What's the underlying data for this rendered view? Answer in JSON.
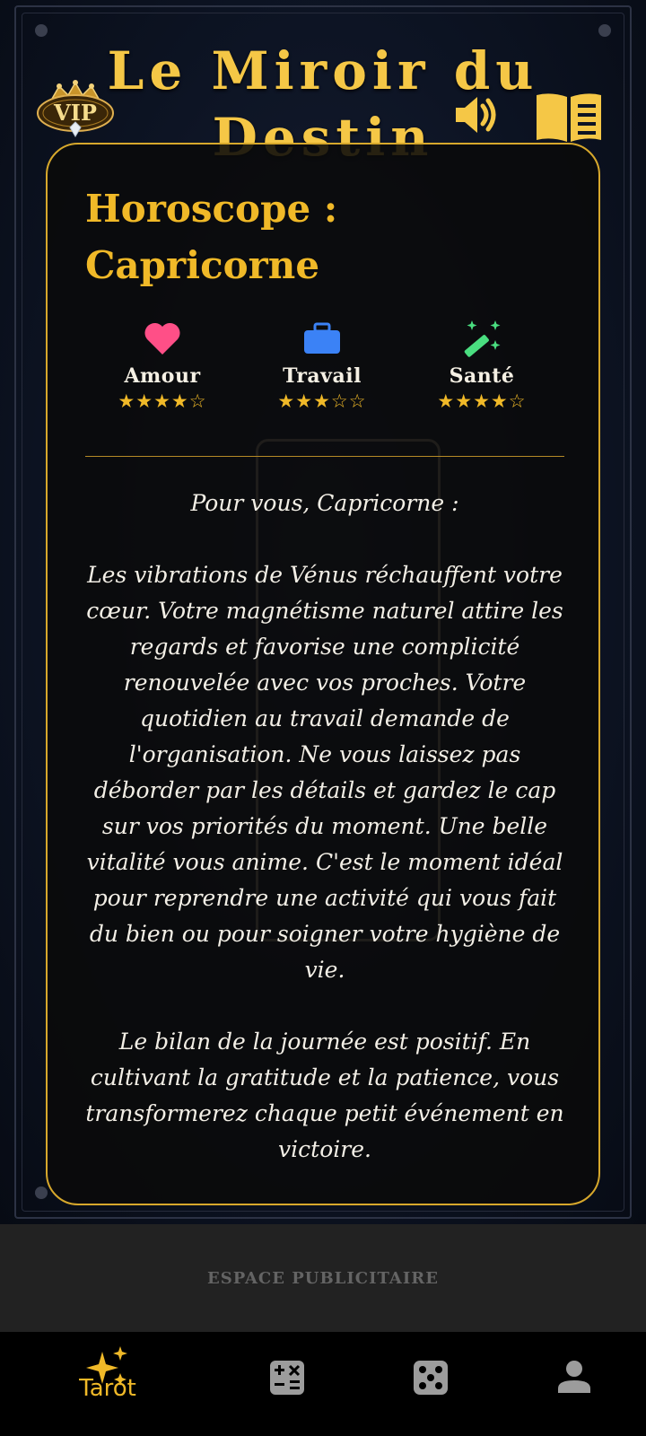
{
  "header": {
    "title": "Le Miroir du Destin",
    "vip_badge": "VIP"
  },
  "horoscope": {
    "title_line1": "Horoscope :",
    "title_line2": "Capricorne",
    "metrics": [
      {
        "label": "Amour",
        "rating": 4,
        "max": 5,
        "stars": "★★★★☆",
        "icon": "heart-icon",
        "color": "#ff4f87"
      },
      {
        "label": "Travail",
        "rating": 3,
        "max": 5,
        "stars": "★★★☆☆",
        "icon": "briefcase-icon",
        "color": "#3b82f6"
      },
      {
        "label": "Santé",
        "rating": 4,
        "max": 5,
        "stars": "★★★★☆",
        "icon": "magic-wand-icon",
        "color": "#4ade80"
      }
    ],
    "intro": "Pour vous, Capricorne :",
    "paragraph1": "Les vibrations de Vénus réchauffent votre cœur. Votre magnétisme naturel attire les regards et favorise une complicité renouvelée avec vos proches. Votre quotidien au travail demande de l'organisation. Ne vous laissez pas déborder par les détails et gardez le cap sur vos priorités du moment. Une belle vitalité vous anime. C'est le moment idéal pour reprendre une activité qui vous fait du bien ou pour soigner votre hygiène de vie.",
    "paragraph2": "Le bilan de la journée est positif. En cultivant la gratitude et la patience, vous transformerez chaque petit événement en victoire."
  },
  "ad": {
    "label": "ESPACE PUBLICITAIRE"
  },
  "nav": {
    "items": [
      {
        "label": "Tarot",
        "icon": "sparkles-icon",
        "active": true
      },
      {
        "label": "",
        "icon": "calculator-icon",
        "active": false
      },
      {
        "label": "",
        "icon": "dice-icon",
        "active": false
      },
      {
        "label": "",
        "icon": "person-icon",
        "active": false
      }
    ]
  },
  "colors": {
    "accent_gold": "#f0b928",
    "title_gold": "#f5c746",
    "card_border": "#d7a82c"
  }
}
